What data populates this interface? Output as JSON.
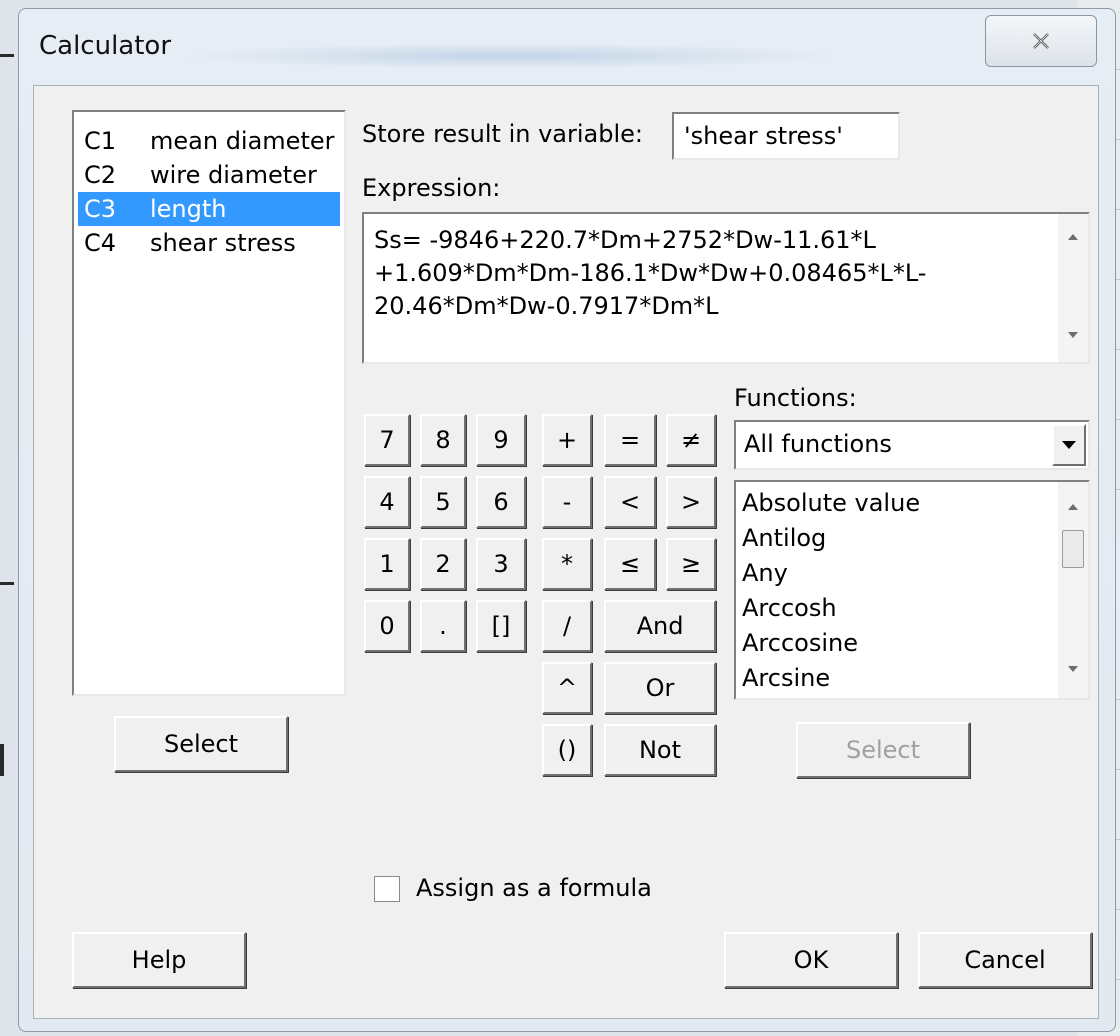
{
  "window": {
    "title": "Calculator"
  },
  "variables": [
    {
      "col": "C1",
      "name": "mean diameter",
      "selected": false
    },
    {
      "col": "C2",
      "name": "wire diameter",
      "selected": false
    },
    {
      "col": "C3",
      "name": "length",
      "selected": true
    },
    {
      "col": "C4",
      "name": "shear stress",
      "selected": false
    }
  ],
  "store_label": "Store result in variable:",
  "store_value": "'shear stress'",
  "expression_label": "Expression:",
  "expression_lines": [
    "Ss= -9846+220.7*Dm+2752*Dw-11.61*L",
    "+1.609*Dm*Dm-186.1*Dw*Dw+0.08465*L*L-",
    "20.46*Dm*Dw-0.7917*Dm*L"
  ],
  "keypad": {
    "digits": [
      "7",
      "8",
      "9",
      "4",
      "5",
      "6",
      "1",
      "2",
      "3",
      "0",
      ".",
      "[]"
    ],
    "ops": [
      "+",
      "-",
      "*",
      "/",
      "^",
      "()"
    ],
    "comparisons": [
      "=",
      "≠",
      "<",
      ">",
      "≤",
      "≥"
    ],
    "logical": [
      "And",
      "Or",
      "Not"
    ]
  },
  "functions_label": "Functions:",
  "functions_dropdown": "All functions",
  "functions_list": [
    "Absolute value",
    "Antilog",
    "Any",
    "Arccosh",
    "Arccosine",
    "Arcsine"
  ],
  "select_label": "Select",
  "select_disabled_label": "Select",
  "assign_formula_label": "Assign as a formula",
  "assign_formula_checked": false,
  "buttons": {
    "help": "Help",
    "ok": "OK",
    "cancel": "Cancel"
  }
}
